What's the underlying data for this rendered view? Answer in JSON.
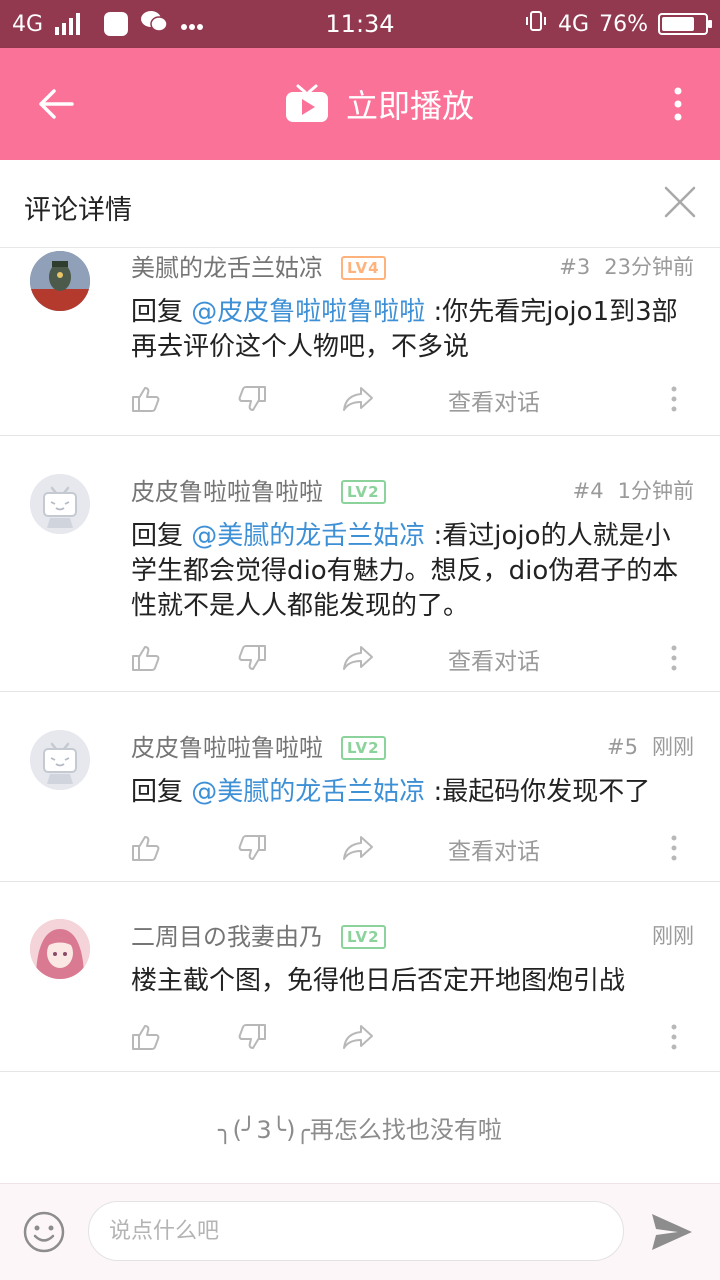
{
  "status_bar": {
    "network_left": "4G",
    "time": "11:34",
    "network_right": "4G",
    "battery": "76%",
    "battery_level": 0.76
  },
  "app_bar": {
    "title": "立即播放",
    "back_icon": "arrow-left-icon",
    "tv_icon": "bilibili-tv-icon",
    "more_icon": "more-vertical-icon"
  },
  "detail": {
    "title": "评论详情",
    "close_icon": "close-icon"
  },
  "comments": [
    {
      "user": "美腻的龙舌兰姑凉",
      "level": "LV4",
      "floor": "#3",
      "time": "23分钟前",
      "prefix": "回复 ",
      "mention": "@皮皮鲁啦啦鲁啦啦",
      "text": " :你先看完jojo1到3部再去评价这个人物吧，不多说",
      "view_conversation": "查看对话"
    },
    {
      "user": "皮皮鲁啦啦鲁啦啦",
      "level": "LV2",
      "floor": "#4",
      "time": "1分钟前",
      "prefix": "回复 ",
      "mention": "@美腻的龙舌兰姑凉",
      "text": " :看过jojo的人就是小学生都会觉得dio有魅力。想反，dio伪君子的本性就不是人人都能发现的了。",
      "view_conversation": "查看对话"
    },
    {
      "user": "皮皮鲁啦啦鲁啦啦",
      "level": "LV2",
      "floor": "#5",
      "time": "刚刚",
      "prefix": "回复 ",
      "mention": "@美腻的龙舌兰姑凉",
      "text": " :最起码你发现不了",
      "view_conversation": "查看对话"
    },
    {
      "user": "二周目の我妻由乃",
      "level": "LV2",
      "floor": "",
      "time": "刚刚",
      "prefix": "",
      "mention": "",
      "text": "楼主截个图，免得他日后否定开地图炮引战",
      "view_conversation": ""
    }
  ],
  "end_note": "╮(╯3╰)╭再怎么找也没有啦",
  "input": {
    "placeholder": "说点什么吧",
    "value": "",
    "emoji_icon": "smiley-icon",
    "send_icon": "send-icon"
  },
  "colors": {
    "status_bar": "#92384f",
    "app_bar": "#fb7299",
    "mention": "#3e90d6",
    "lv4": "#ffb37c",
    "lv2": "#8bd29b"
  }
}
